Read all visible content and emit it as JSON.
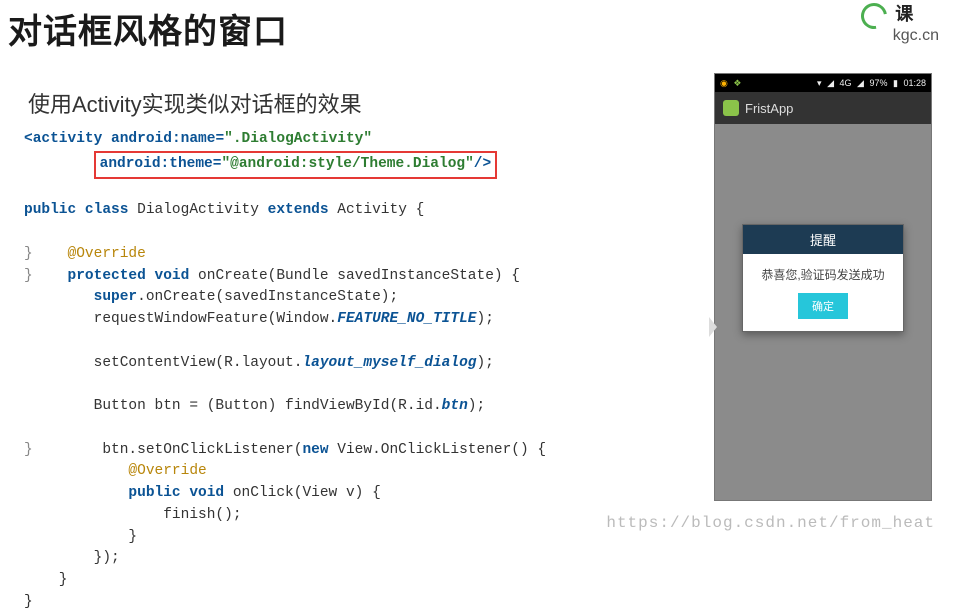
{
  "heading": "对话框风格的窗口",
  "subheading": "使用Activity实现类似对话框的效果",
  "logo": {
    "text_top": "课",
    "text_sub": "kgc.cn"
  },
  "code": {
    "l1a": "<activity",
    "l1b": "android:name=",
    "l1c": "\".DialogActivity\"",
    "l2a": "android:theme=",
    "l2b": "\"@android:style/Theme.Dialog\"",
    "l2c": "/>",
    "l3a": "public class",
    "l3b": " DialogActivity ",
    "l3c": "extends",
    "l3d": " Activity {",
    "l4": "",
    "l5": "    @Override",
    "l6a": "    protected void",
    "l6b": " onCreate(Bundle savedInstanceState) {",
    "l7a": "        super",
    "l7b": ".onCreate(savedInstanceState);",
    "l8a": "        requestWindowFeature(Window.",
    "l8b": "FEATURE_NO_TITLE",
    "l8c": ");",
    "l9": "",
    "l10a": "        setContentView(R.layout.",
    "l10b": "layout_myself_dialog",
    "l10c": ");",
    "l11": "",
    "l12a": "        Button btn = (Button) findViewById(R.id.",
    "l12b": "btn",
    "l12c": ");",
    "l13": "",
    "l14a": "        btn.setOnClickListener(",
    "l14b": "new",
    "l14c": " View.OnClickListener() {",
    "l15": "            @Override",
    "l16a": "            public void",
    "l16b": " onClick(View v) {",
    "l17": "                finish();",
    "l18": "            }",
    "l19": "        });",
    "l20": "    }",
    "l21": "}",
    "gutter1": "}",
    "gutter2": "}",
    "gutter3": "}"
  },
  "phone": {
    "status": {
      "time": "01:28",
      "battery": "97%",
      "net": "4G"
    },
    "app_name": "FristApp",
    "dialog_title": "提醒",
    "dialog_body": "恭喜您,验证码发送成功",
    "dialog_btn": "确定"
  },
  "watermark": "https://blog.csdn.net/from_heat"
}
